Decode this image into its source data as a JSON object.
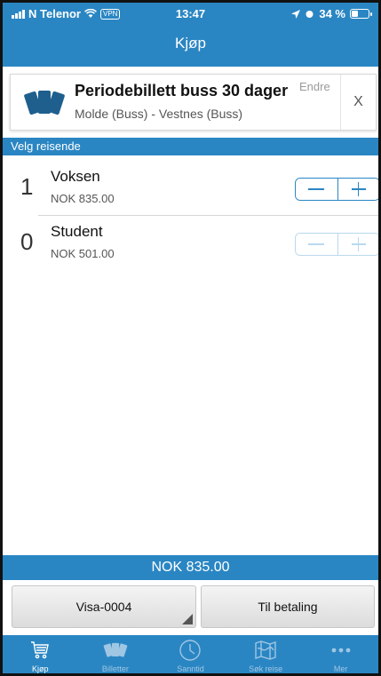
{
  "status_bar": {
    "carrier": "N Telenor",
    "vpn": "VPN",
    "time": "13:47",
    "battery": "34 %"
  },
  "header": {
    "title": "Kjøp"
  },
  "ticket": {
    "title": "Periodebillett buss 30 dager",
    "route": "Molde (Buss) - Vestnes (Buss)",
    "edit_label": "Endre",
    "close_label": "X",
    "icon": "tickets-icon"
  },
  "section": {
    "label": "Velg reisende"
  },
  "travellers": [
    {
      "count": "1",
      "name": "Voksen",
      "price": "NOK 835.00",
      "stepper_enabled": true
    },
    {
      "count": "0",
      "name": "Student",
      "price": "NOK 501.00",
      "stepper_enabled": false
    }
  ],
  "total": {
    "label": "NOK 835.00"
  },
  "actions": {
    "payment_card": "Visa-0004",
    "pay": "Til betaling"
  },
  "tabbar": {
    "items": [
      {
        "label": "Kjøp",
        "icon": "cart-icon",
        "active": true
      },
      {
        "label": "Billetter",
        "icon": "tickets-icon",
        "active": false
      },
      {
        "label": "Sanntid",
        "icon": "clock-icon",
        "active": false
      },
      {
        "label": "Søk reise",
        "icon": "map-icon",
        "active": false
      },
      {
        "label": "Mer",
        "icon": "more-icon",
        "active": false
      }
    ]
  },
  "colors": {
    "brand_blue": "#2a86c3",
    "tab_inactive": "#9fc6e3"
  }
}
